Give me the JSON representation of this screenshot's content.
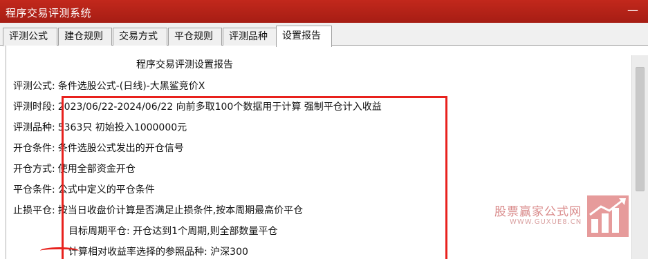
{
  "window": {
    "title": "程序交易评测系统",
    "minimize_glyph": "—"
  },
  "tabs": [
    {
      "label": "评测公式"
    },
    {
      "label": "建仓规则"
    },
    {
      "label": "交易方式"
    },
    {
      "label": "平仓规则"
    },
    {
      "label": "评测品种"
    },
    {
      "label": "设置报告",
      "active": true
    }
  ],
  "report": {
    "title": "程序交易评测设置报告",
    "rows": [
      {
        "label": "评测公式:",
        "value": "条件选股公式-(日线)-大黑鲨竞价X"
      },
      {
        "label": "评测时段:",
        "value": "2023/06/22-2024/06/22 向前多取100个数据用于计算 强制平仓计入收益"
      },
      {
        "label": "评测品种:",
        "value": "5363只 初始投入1000000元"
      },
      {
        "label": "开仓条件:",
        "value": "条件选股公式发出的开仓信号"
      },
      {
        "label": "开仓方式:",
        "value": "使用全部资金开仓"
      },
      {
        "label": "平仓条件:",
        "value": "公式中定义的平仓条件"
      },
      {
        "label": "止损平仓:",
        "value": "按当日收盘价计算是否满足止损条件,按本周期最高价平仓"
      }
    ],
    "extra_lines": [
      "目标周期平仓: 开仓达到1个周期,则全部数量平仓",
      "计算相对收益率选择的参照品种: 沪深300"
    ]
  },
  "watermark": {
    "name": "股票赢家公式网",
    "url": "WWW.GUXUE8.CN"
  },
  "colors": {
    "titlebar": "#b5231a",
    "highlight": "#e8211d",
    "watermark": "#e69b9b"
  }
}
